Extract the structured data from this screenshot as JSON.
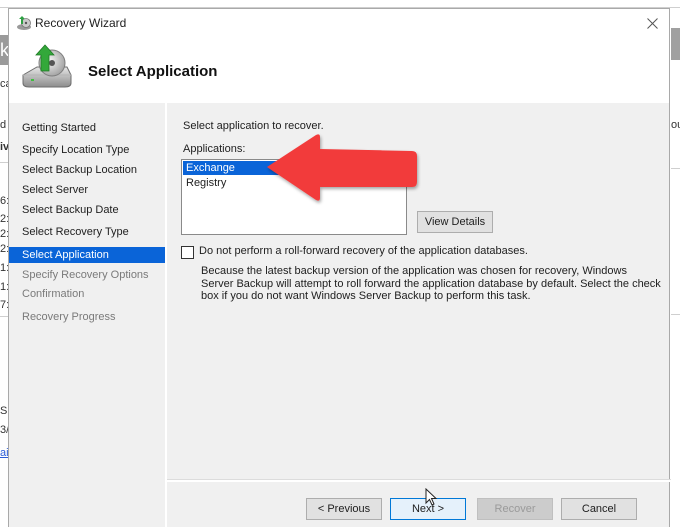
{
  "background_window": {
    "header_fragment": "k",
    "fragments": [
      "ca",
      "d",
      "iv",
      "6:",
      "2:",
      "2:",
      "2:",
      "1:",
      "1:",
      "7:",
      "Su",
      "3/"
    ],
    "link_fragment": "ai",
    "right_fragment": "ou"
  },
  "dialog": {
    "title": "Recovery Wizard",
    "close_icon": "close-icon",
    "header": {
      "title": "Select Application",
      "icon": "backup-restore-icon"
    },
    "steps": [
      {
        "label": "Getting Started",
        "state": "done"
      },
      {
        "label": "Specify Location Type",
        "state": "done"
      },
      {
        "label": "Select Backup Location",
        "state": "done"
      },
      {
        "label": "Select Server",
        "state": "done"
      },
      {
        "label": "Select Backup Date",
        "state": "done"
      },
      {
        "label": "Select Recovery Type",
        "state": "done"
      },
      {
        "label": "Select Application",
        "state": "active"
      },
      {
        "label": "Specify Recovery Options",
        "state": "future"
      },
      {
        "label": "Confirmation",
        "state": "future"
      },
      {
        "label": "Recovery Progress",
        "state": "future"
      }
    ],
    "content": {
      "instruction": "Select application to recover.",
      "applications_label": "Applications:",
      "applications": [
        {
          "name": "Exchange",
          "selected": true
        },
        {
          "name": "Registry",
          "selected": false
        }
      ],
      "view_details_label": "View Details",
      "rollforward_checkbox": {
        "label": "Do not perform a roll-forward recovery of the application databases.",
        "checked": false
      },
      "explanation": "Because the latest backup version of the application was chosen for recovery, Windows Server Backup will attempt to roll forward the application database by default. Select the check box if you do not want Windows Server Backup to perform this task."
    },
    "buttons": {
      "previous": "< Previous",
      "next": "Next >",
      "recover": "Recover",
      "cancel": "Cancel"
    }
  },
  "annotation": {
    "type": "arrow",
    "color": "#f23b3b",
    "points_to": "Exchange"
  },
  "colors": {
    "selection": "#0a64d8",
    "panel_bg": "#f0f0f0"
  }
}
